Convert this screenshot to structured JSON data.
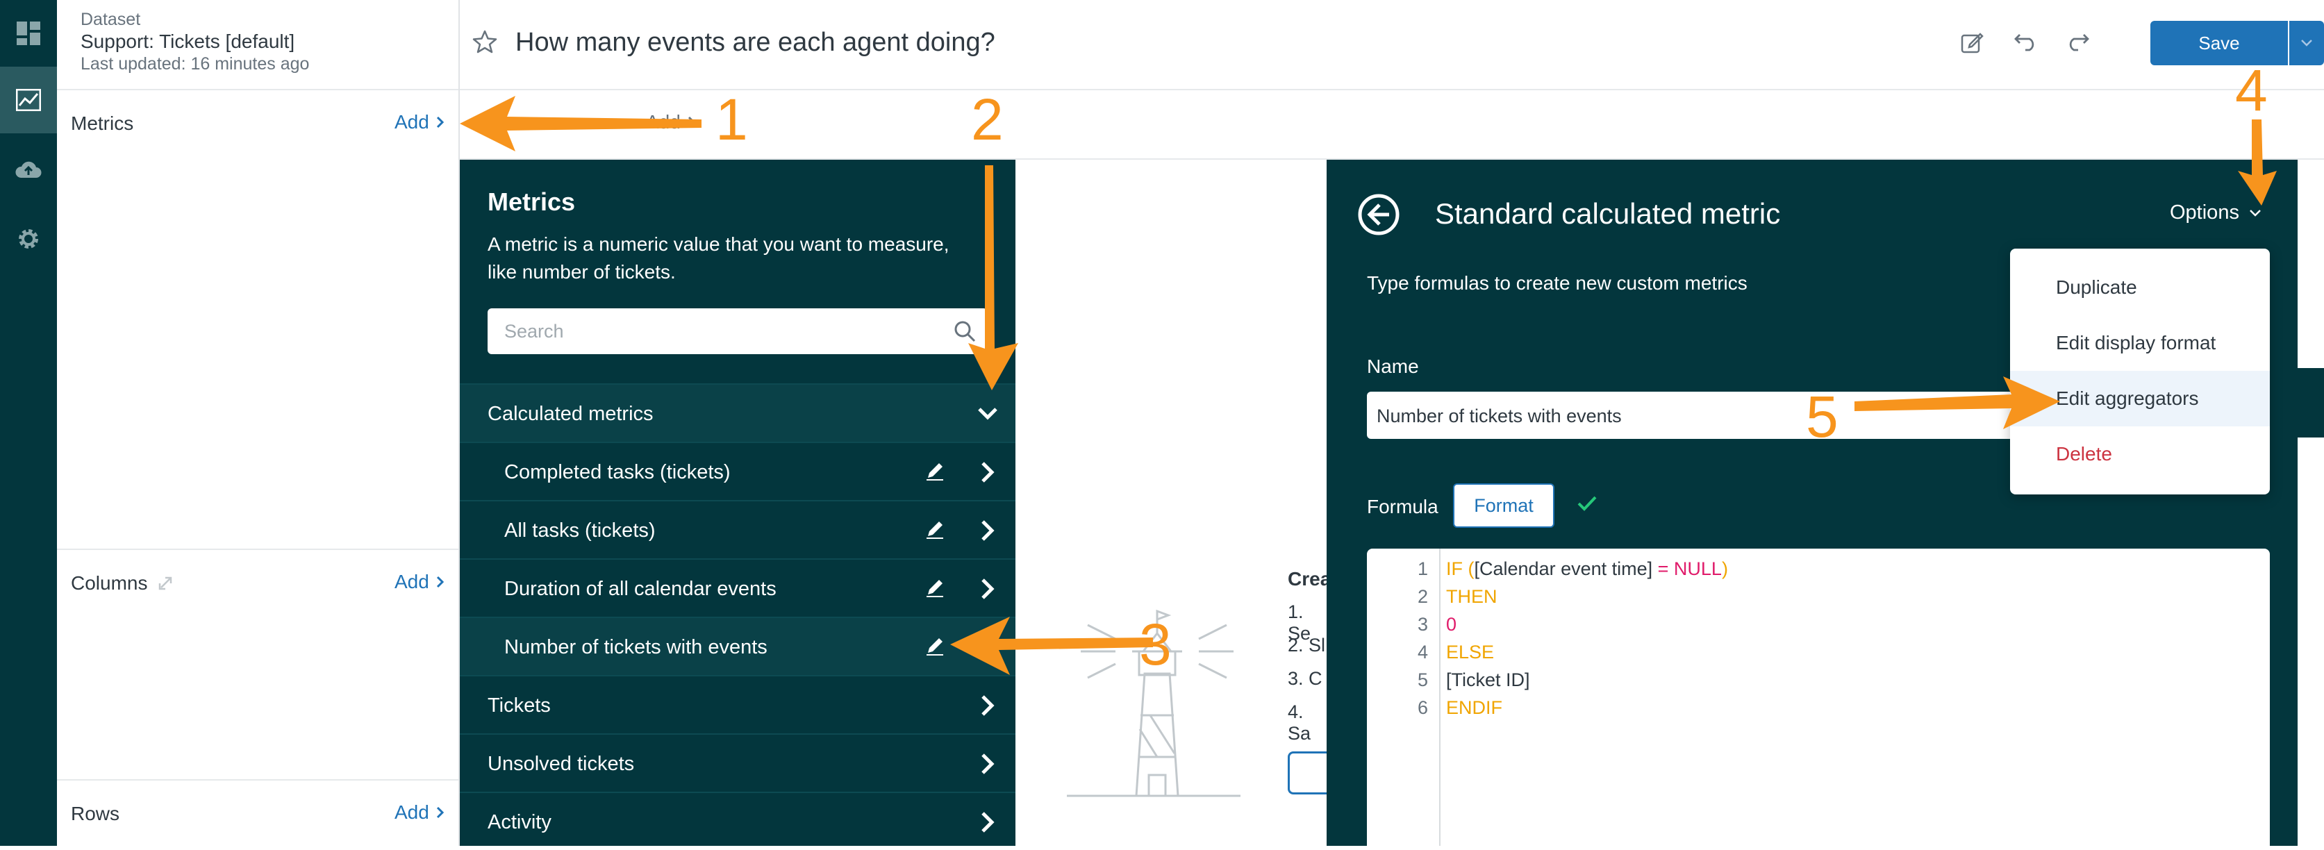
{
  "nav": {
    "icons": [
      "dashboard-icon",
      "chart-icon",
      "cloud-upload-icon",
      "gear-icon"
    ]
  },
  "dataset": {
    "label": "Dataset",
    "name": "Support: Tickets [default]",
    "updated": "Last updated: 16 minutes ago"
  },
  "left_panel": {
    "metrics_label": "Metrics",
    "metrics_add": "Add",
    "columns_label": "Columns",
    "columns_add": "Add",
    "rows_label": "Rows",
    "rows_add": "Add"
  },
  "header": {
    "title": "How many events are each agent doing?",
    "save_label": "Save"
  },
  "subheader": {
    "add_label": "Add"
  },
  "metrics_panel": {
    "title": "Metrics",
    "description_line1": "A metric is a numeric value that you want to measure,",
    "description_line2": "like number of tickets.",
    "search_placeholder": "Search",
    "groups": [
      {
        "label": "Calculated metrics"
      },
      {
        "label": "Completed tasks (tickets)"
      },
      {
        "label": "All tasks (tickets)"
      },
      {
        "label": "Duration of all calendar events"
      },
      {
        "label": "Number of tickets with events"
      },
      {
        "label": "Tickets"
      },
      {
        "label": "Unsolved tickets"
      },
      {
        "label": "Activity"
      }
    ]
  },
  "middle": {
    "create_prefix": "Crea",
    "steps": [
      "1. Se",
      "2. Sl",
      "3. C",
      "4. Sa"
    ]
  },
  "calc_panel": {
    "title": "Standard calculated metric",
    "options_label": "Options",
    "subtitle": "Type formulas to create new custom metrics",
    "name_label": "Name",
    "name_value": "Number of tickets with events",
    "formula_label": "Formula",
    "format_button": "Format",
    "code_lines": [
      {
        "num": "1",
        "parts": [
          "IF (",
          "[Calendar event time]",
          " = ",
          "NULL",
          ")"
        ]
      },
      {
        "num": "2",
        "text": "THEN"
      },
      {
        "num": "3",
        "text": "0"
      },
      {
        "num": "4",
        "text": "ELSE"
      },
      {
        "num": "5",
        "text": "[Ticket ID]"
      },
      {
        "num": "6",
        "text": "ENDIF"
      }
    ]
  },
  "options_menu": {
    "items": [
      "Duplicate",
      "Edit display format",
      "Edit aggregators",
      "Delete"
    ]
  },
  "annotations": {
    "numbers": [
      "1",
      "2",
      "3",
      "4",
      "5"
    ],
    "color": "#f7941d"
  },
  "colors": {
    "panel_dark": "#03363d",
    "link_blue": "#1f73b7",
    "danger": "#cc3340"
  }
}
